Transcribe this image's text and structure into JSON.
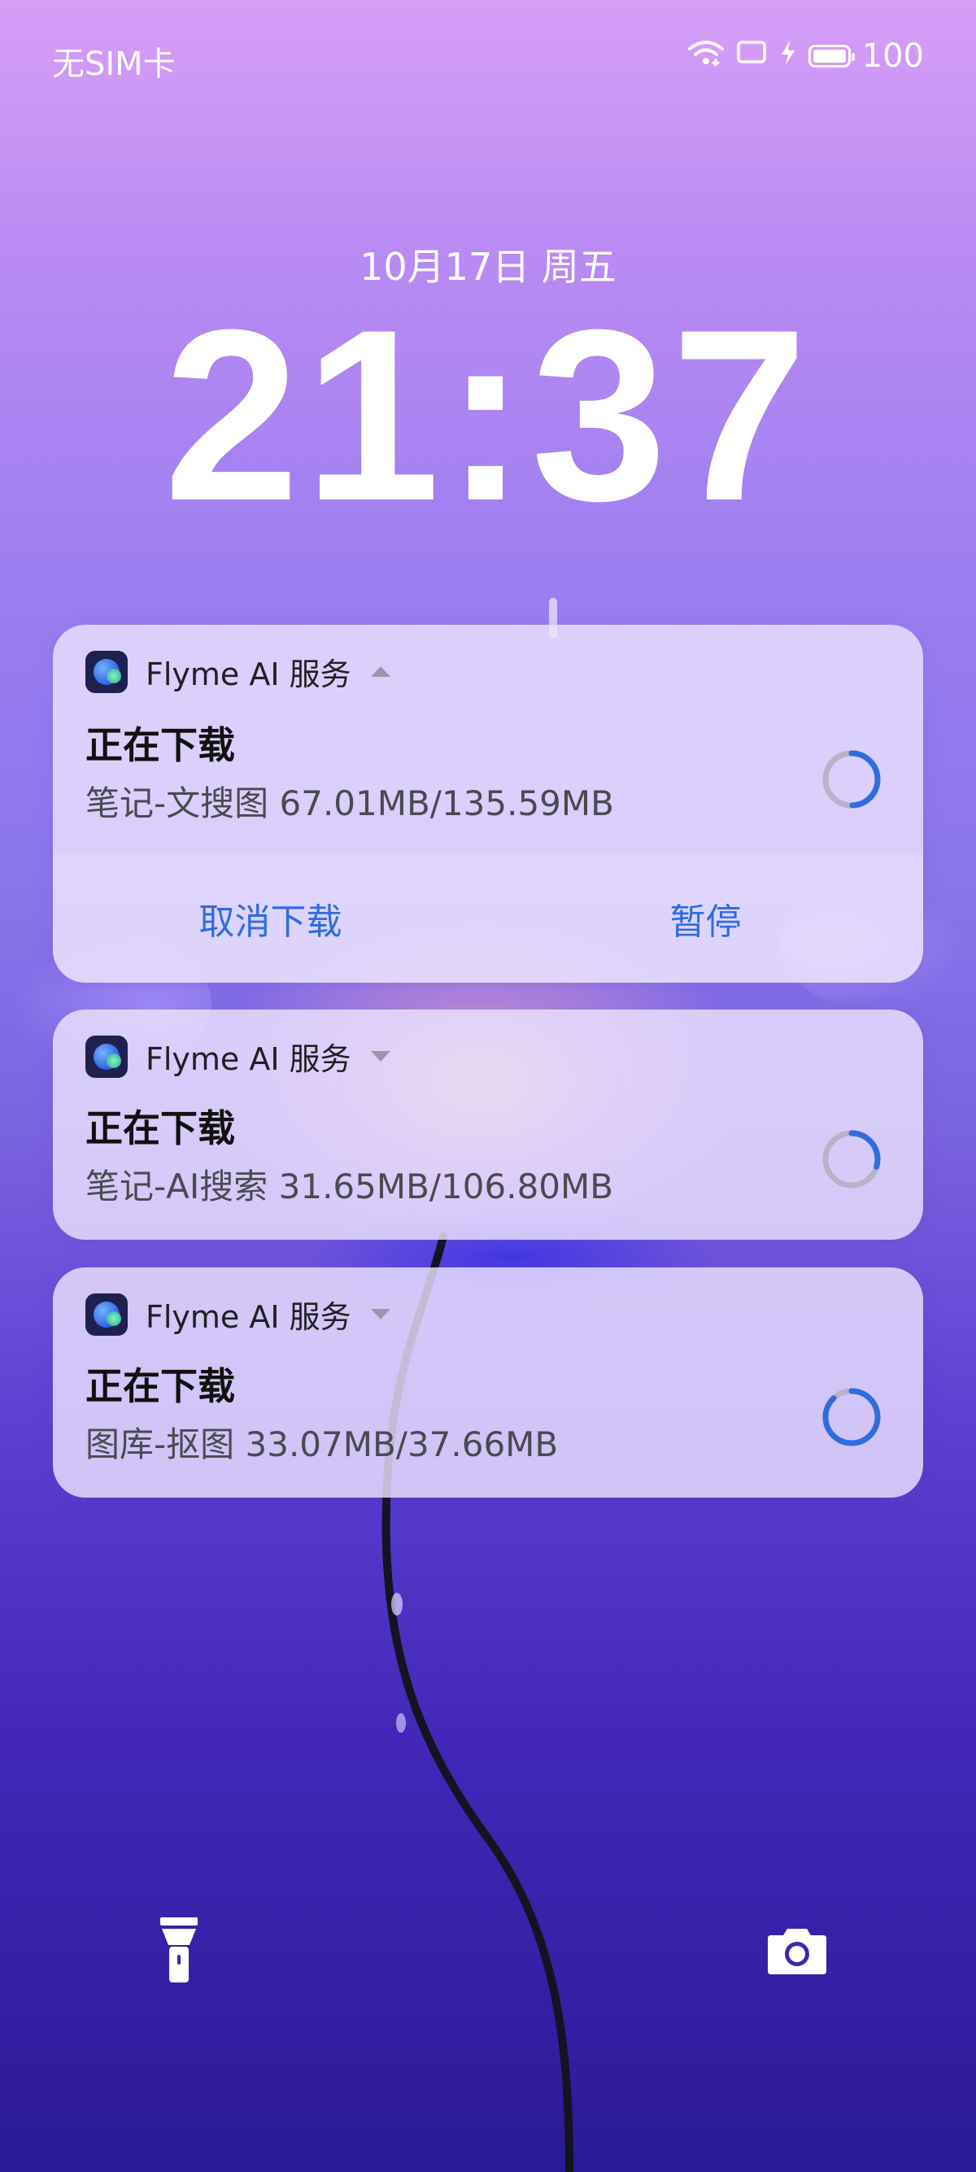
{
  "status_bar": {
    "carrier": "无SIM卡",
    "battery_level": "100",
    "icons": [
      "wifi-icon",
      "cast-icon",
      "charge-icon",
      "battery-icon"
    ]
  },
  "lockscreen": {
    "date": "10月17日 周五",
    "time": "21:37"
  },
  "notifications": [
    {
      "app_name": "Flyme AI 服务",
      "expanded": true,
      "title": "正在下载",
      "subtitle": "笔记-文搜图 67.01MB/135.59MB",
      "progress": 0.494,
      "actions": [
        "取消下载",
        "暂停"
      ]
    },
    {
      "app_name": "Flyme AI 服务",
      "expanded": false,
      "title": "正在下载",
      "subtitle": "笔记-AI搜索 31.65MB/106.80MB",
      "progress": 0.296
    },
    {
      "app_name": "Flyme AI 服务",
      "expanded": false,
      "title": "正在下载",
      "subtitle": "图库-抠图 33.07MB/37.66MB",
      "progress": 0.878
    }
  ],
  "shortcuts": [
    "flashlight-icon",
    "camera-icon"
  ],
  "colors": {
    "accent": "#2f6ce0",
    "progress_track": "#b9b3c9"
  }
}
